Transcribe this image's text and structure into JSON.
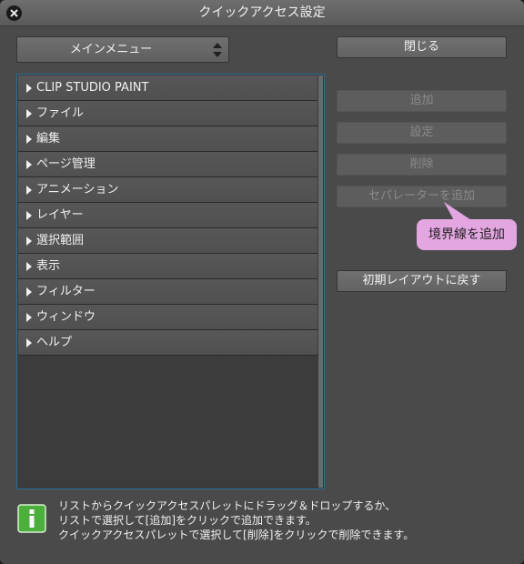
{
  "window": {
    "title": "クイックアクセス設定"
  },
  "menu_select": {
    "value": "メインメニュー"
  },
  "buttons": {
    "close": "閉じる",
    "add": "追加",
    "settings": "設定",
    "delete": "削除",
    "add_separator": "セパレーターを追加",
    "reset_layout": "初期レイアウトに戻す"
  },
  "tooltip": {
    "text": "境界線を追加"
  },
  "menu_items": [
    {
      "label": "CLIP STUDIO PAINT"
    },
    {
      "label": "ファイル"
    },
    {
      "label": "編集"
    },
    {
      "label": "ページ管理"
    },
    {
      "label": "アニメーション"
    },
    {
      "label": "レイヤー"
    },
    {
      "label": "選択範囲"
    },
    {
      "label": "表示"
    },
    {
      "label": "フィルター"
    },
    {
      "label": "ウィンドウ"
    },
    {
      "label": "ヘルプ"
    }
  ],
  "help_text": [
    "リストからクイックアクセスパレットにドラッグ＆ドロップするか、",
    "リストで選択して[追加]をクリックで追加できます。",
    "クイックアクセスパレットで選択して[削除]をクリックで削除できます。"
  ],
  "colors": {
    "accent_border": "#2b6f97",
    "tooltip_bg": "#e3a6e0",
    "info_icon": "#4caf3c"
  }
}
